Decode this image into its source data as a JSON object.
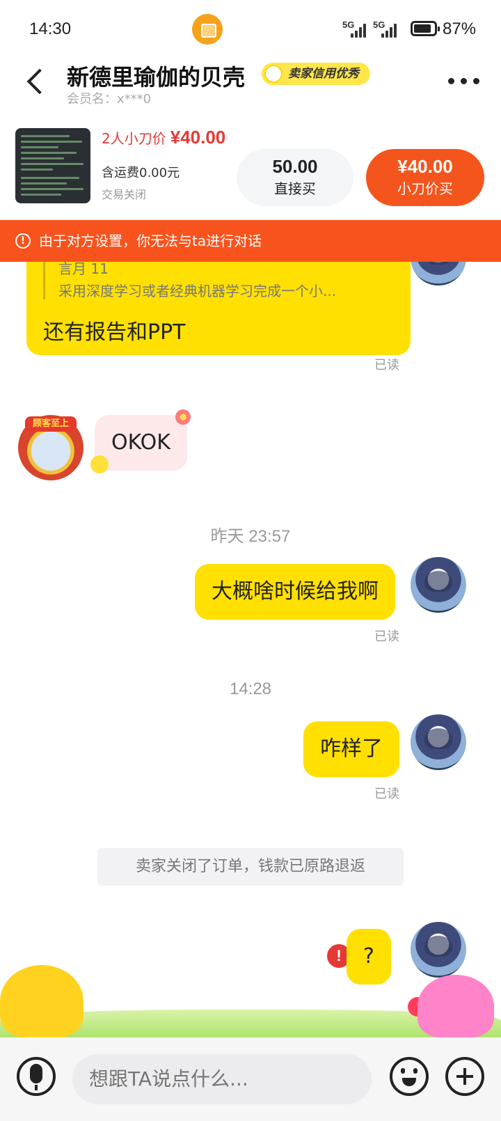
{
  "status": {
    "time": "14:30",
    "net1": "5G",
    "net2": "5G",
    "battery_pct": "87%",
    "battery_level": 0.87
  },
  "header": {
    "title": "新德里瑜伽的贝壳",
    "badge": "卖家信用优秀",
    "member": "会员名：x***0"
  },
  "product": {
    "price_label": "2人小刀价",
    "price_value": "¥40.00",
    "shipping": "含运费0.00元",
    "status": "交易关闭",
    "direct_price": "50.00",
    "direct_label": "直接买",
    "cut_price": "¥40.00",
    "cut_label": "小刀价买"
  },
  "warning": {
    "icon": "!",
    "text": "由于对方设置，你无法与ta进行对话"
  },
  "messages": {
    "quote_head": "言月 11",
    "quote_text": "采用深度学习或者经典机器学习完成一个小...",
    "quote_reply": "还有报告和PPT",
    "read": "已读",
    "left_msg": "OKOK",
    "left_badge": "顾客至上",
    "time1": "昨天 23:57",
    "msg2": "大概啥时候给我啊",
    "time2": "14:28",
    "msg3": "咋样了",
    "system": "卖家关闭了订单，钱款已原路退返",
    "msg4": "?",
    "fail": "!"
  },
  "input": {
    "placeholder": "想跟TA说点什么..."
  }
}
